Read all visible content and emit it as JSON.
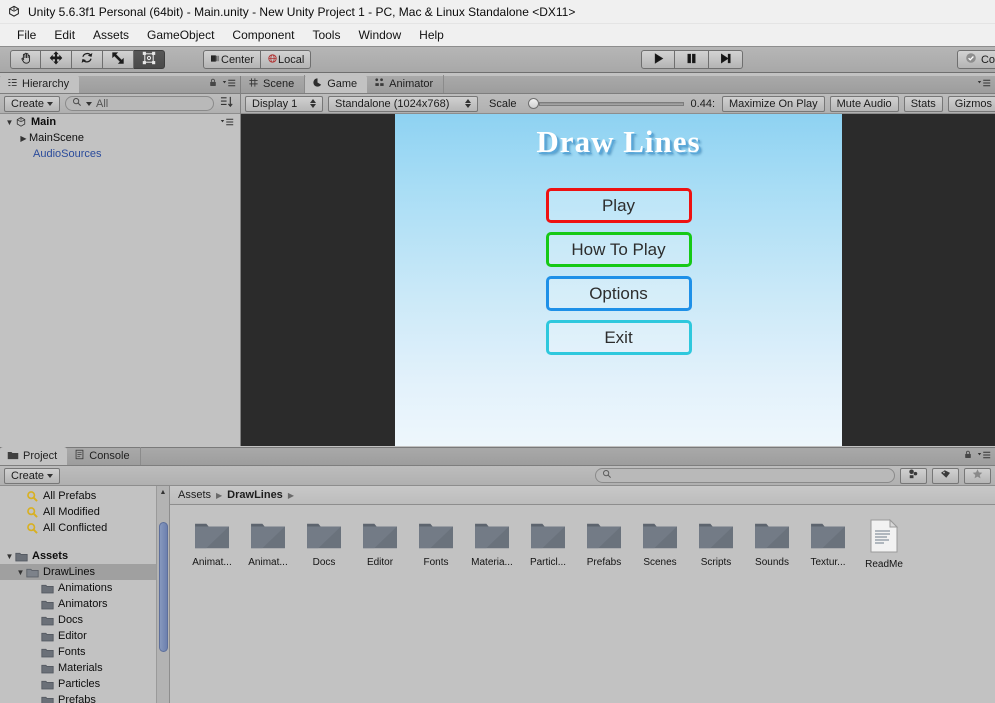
{
  "window": {
    "title": "Unity 5.6.3f1 Personal (64bit) - Main.unity - New Unity Project 1 - PC, Mac & Linux Standalone <DX11>",
    "logo_icon": "unity-logo-icon"
  },
  "menubar": {
    "items": [
      "File",
      "Edit",
      "Assets",
      "GameObject",
      "Component",
      "Tools",
      "Window",
      "Help"
    ]
  },
  "toolbar": {
    "tools": [
      {
        "name": "hand-tool",
        "icon": "hand-icon",
        "active": false
      },
      {
        "name": "move-tool",
        "icon": "move-arrows-icon",
        "active": false
      },
      {
        "name": "rotate-tool",
        "icon": "rotate-icon",
        "active": false
      },
      {
        "name": "scale-tool",
        "icon": "scale-icon",
        "active": false
      },
      {
        "name": "rect-tool",
        "icon": "rect-transform-icon",
        "active": true
      }
    ],
    "pivot_label": "Center",
    "pivot_icon": "pivot-center-icon",
    "space_label": "Local",
    "space_icon": "local-space-icon",
    "play_label": "",
    "play_icon": "play-icon",
    "pause_icon": "pause-icon",
    "step_icon": "step-icon",
    "collab_label": "Co",
    "collab_icon": "collab-check-icon"
  },
  "hierarchy": {
    "tab_label": "Hierarchy",
    "tab_icon": "hierarchy-icon",
    "create_label": "Create",
    "search_placeholder": "All",
    "search_value": "",
    "search_icon": "search-icon",
    "sort_icon": "sort-type-icon",
    "lock_icon": "lock-icon",
    "menu_icon": "panel-menu-icon",
    "rows": [
      {
        "label": "Main",
        "indent": 0,
        "expanded": true,
        "bold": true,
        "icon": "unity-scene-icon",
        "prefab": false
      },
      {
        "label": "MainScene",
        "indent": 1,
        "expanded": false,
        "bold": false,
        "icon": "",
        "prefab": false
      },
      {
        "label": "AudioSources",
        "indent": 2,
        "expanded": null,
        "bold": false,
        "icon": "",
        "prefab": true
      }
    ]
  },
  "gameview": {
    "tabs": [
      {
        "label": "Scene",
        "icon": "scene-icon",
        "active": false
      },
      {
        "label": "Game",
        "icon": "game-icon",
        "active": true
      },
      {
        "label": "Animator",
        "icon": "animator-icon",
        "active": false
      }
    ],
    "display_label": "Display 1",
    "aspect_label": "Standalone (1024x768)",
    "scale_label": "Scale",
    "scale_value": "0.44:",
    "maximize_label": "Maximize On Play",
    "mute_label": "Mute Audio",
    "stats_label": "Stats",
    "gizmos_label": "Gizmos",
    "menu_icon": "panel-menu-icon",
    "game": {
      "title": "Draw Lines",
      "buttons": [
        {
          "label": "Play",
          "border": "#ee1111"
        },
        {
          "label": "How To Play",
          "border": "#16c916"
        },
        {
          "label": "Options",
          "border": "#1e90e8"
        },
        {
          "label": "Exit",
          "border": "#2ec8dd"
        }
      ]
    }
  },
  "project": {
    "tabs": [
      {
        "label": "Project",
        "icon": "folder-icon",
        "active": true
      },
      {
        "label": "Console",
        "icon": "console-icon",
        "active": false
      }
    ],
    "create_label": "Create",
    "search_placeholder": "",
    "search_value": "",
    "search_icon": "search-icon",
    "filter_type_icon": "filter-by-type-icon",
    "filter_label_icon": "filter-by-label-icon",
    "favorite_icon": "star-icon",
    "lock_icon": "lock-icon",
    "menu_icon": "panel-menu-icon",
    "tree": [
      {
        "label": "All Prefabs",
        "indent": 1,
        "icon": "search-saved-icon",
        "type": "search",
        "selected": false,
        "expanded": null
      },
      {
        "label": "All Modified",
        "indent": 1,
        "icon": "search-saved-icon",
        "type": "search",
        "selected": false,
        "expanded": null
      },
      {
        "label": "All Conflicted",
        "indent": 1,
        "icon": "search-saved-icon",
        "type": "search",
        "selected": false,
        "expanded": null
      },
      {
        "label": "",
        "indent": 0,
        "icon": "",
        "type": "spacer",
        "selected": false,
        "expanded": null
      },
      {
        "label": "Assets",
        "indent": 0,
        "icon": "folder-icon",
        "type": "folder",
        "selected": false,
        "expanded": true
      },
      {
        "label": "DrawLines",
        "indent": 1,
        "icon": "folder-icon",
        "type": "folder",
        "selected": true,
        "expanded": true
      },
      {
        "label": "Animations",
        "indent": 2,
        "icon": "folder-icon",
        "type": "folder",
        "selected": false,
        "expanded": null
      },
      {
        "label": "Animators",
        "indent": 2,
        "icon": "folder-icon",
        "type": "folder",
        "selected": false,
        "expanded": null
      },
      {
        "label": "Docs",
        "indent": 2,
        "icon": "folder-icon",
        "type": "folder",
        "selected": false,
        "expanded": null
      },
      {
        "label": "Editor",
        "indent": 2,
        "icon": "folder-icon",
        "type": "folder",
        "selected": false,
        "expanded": null
      },
      {
        "label": "Fonts",
        "indent": 2,
        "icon": "folder-icon",
        "type": "folder",
        "selected": false,
        "expanded": null
      },
      {
        "label": "Materials",
        "indent": 2,
        "icon": "folder-icon",
        "type": "folder",
        "selected": false,
        "expanded": null
      },
      {
        "label": "Particles",
        "indent": 2,
        "icon": "folder-icon",
        "type": "folder",
        "selected": false,
        "expanded": null
      },
      {
        "label": "Prefabs",
        "indent": 2,
        "icon": "folder-icon",
        "type": "folder",
        "selected": false,
        "expanded": null
      }
    ],
    "breadcrumb": [
      "Assets",
      "DrawLines"
    ],
    "assets": [
      {
        "label": "Animat...",
        "type": "folder"
      },
      {
        "label": "Animat...",
        "type": "folder"
      },
      {
        "label": "Docs",
        "type": "folder"
      },
      {
        "label": "Editor",
        "type": "folder"
      },
      {
        "label": "Fonts",
        "type": "folder"
      },
      {
        "label": "Materia...",
        "type": "folder"
      },
      {
        "label": "Particl...",
        "type": "folder"
      },
      {
        "label": "Prefabs",
        "type": "folder"
      },
      {
        "label": "Scenes",
        "type": "folder"
      },
      {
        "label": "Scripts",
        "type": "folder"
      },
      {
        "label": "Sounds",
        "type": "folder"
      },
      {
        "label": "Textur...",
        "type": "folder"
      },
      {
        "label": "ReadMe",
        "type": "textfile"
      }
    ]
  }
}
